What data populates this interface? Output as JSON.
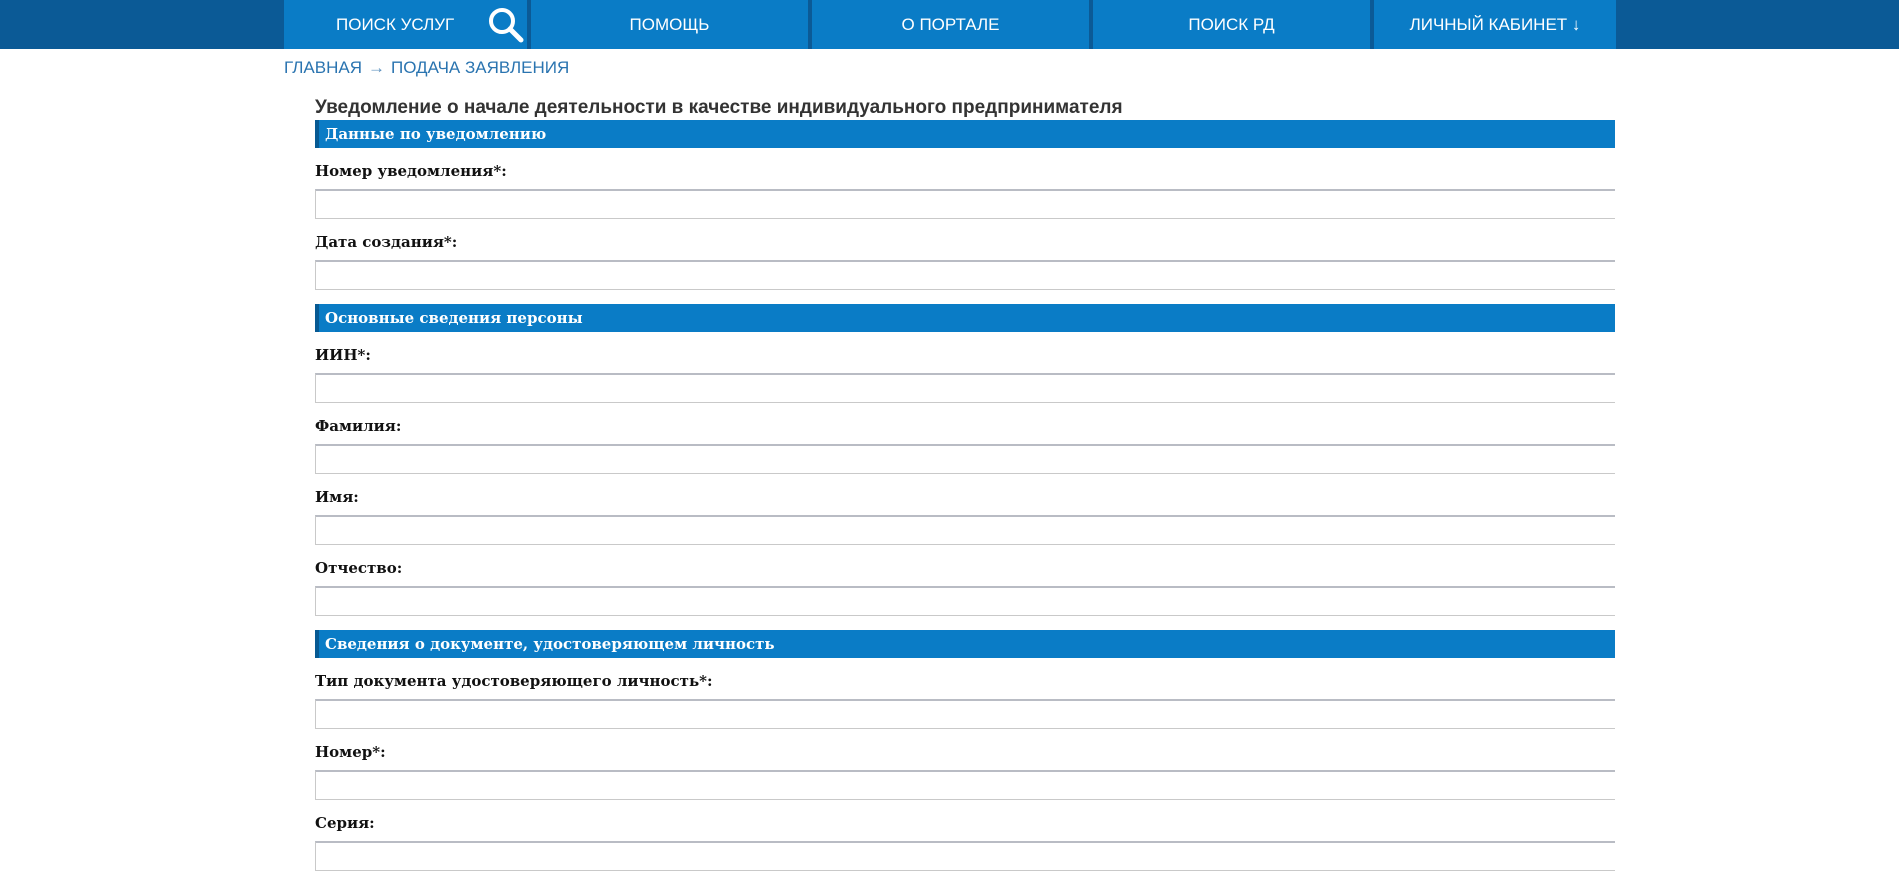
{
  "nav": {
    "items": [
      {
        "label": "ПОИСК УСЛУГ"
      },
      {
        "label": "ПОМОЩЬ"
      },
      {
        "label": "О ПОРТАЛЕ"
      },
      {
        "label": "ПОИСК РД"
      },
      {
        "label": "ЛИЧНЫЙ КАБИНЕТ ↓"
      }
    ],
    "search_icon": "search-icon"
  },
  "breadcrumb": {
    "home": "ГЛАВНАЯ",
    "separator": "→",
    "current": "ПОДАЧА ЗАЯВЛЕНИЯ"
  },
  "page": {
    "title": "Уведомление о начале деятельности в качестве индивидуального предпринимателя"
  },
  "sections": [
    {
      "title": "Данные по уведомлению",
      "fields": [
        {
          "label": "Номер уведомления*:",
          "value": ""
        },
        {
          "label": "Дата создания*:",
          "value": ""
        }
      ]
    },
    {
      "title": "Основные сведения персоны",
      "fields": [
        {
          "label": "ИИН*:",
          "value": ""
        },
        {
          "label": "Фамилия:",
          "value": ""
        },
        {
          "label": "Имя:",
          "value": ""
        },
        {
          "label": "Отчество:",
          "value": ""
        }
      ]
    },
    {
      "title": "Сведения о документе, удостоверяющем личность",
      "fields": [
        {
          "label": "Тип документа удостоверяющего личность*:",
          "value": ""
        },
        {
          "label": "Номер*:",
          "value": ""
        },
        {
          "label": "Серия:",
          "value": ""
        }
      ]
    }
  ],
  "colors": {
    "topbar": "#0b5a96",
    "accent": "#0a7cc6",
    "link": "#2a74b0"
  }
}
